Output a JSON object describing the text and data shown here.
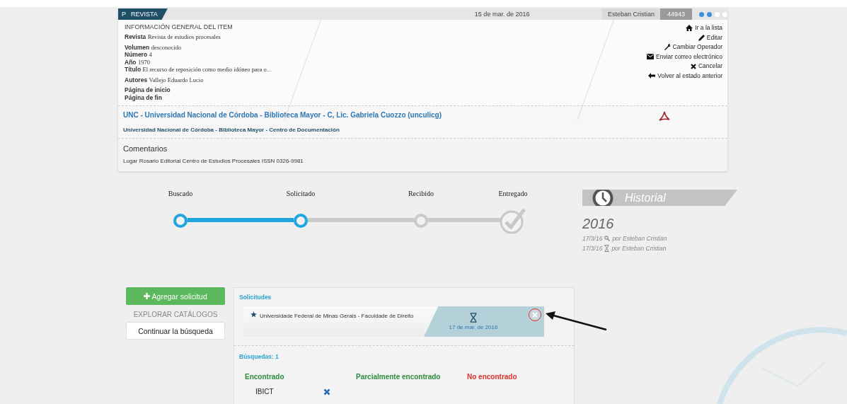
{
  "item": {
    "badge_letter": "P",
    "type": "REVISTA",
    "date": "15 de mar. de 2016",
    "operator": "Esteban Cristian",
    "id": "44943",
    "page_dots": [
      {
        "filled": true
      },
      {
        "filled": true
      },
      {
        "filled": false
      },
      {
        "filled": false
      }
    ],
    "section_title": "INFORMACIÓN GENERAL DEL ITEM",
    "field_groups": [
      [
        {
          "label": "Revista",
          "value": "Revista de estudios procesales"
        }
      ],
      [
        {
          "label": "Volumen",
          "value": "desconocido"
        },
        {
          "label": "Número",
          "value": "4"
        },
        {
          "label": "Año",
          "value": "1970"
        },
        {
          "label": "Título",
          "value": "El recurso de reposición como medio idóneo para o..."
        }
      ],
      [
        {
          "label": "Autores",
          "value": "Vallejo Eduardo Lucio"
        }
      ],
      [
        {
          "label": "Página de inicio"
        },
        {
          "label": "Página de fin"
        }
      ]
    ],
    "actions": [
      {
        "kind": "home",
        "label": "Ir a la lista"
      },
      {
        "kind": "edit",
        "label": "Editar"
      },
      {
        "kind": "wrench",
        "label": "Cambiar Operador"
      },
      {
        "kind": "mail",
        "label": "Enviar correo electrónico"
      },
      {
        "kind": "cancel",
        "label": "Cancelar"
      },
      {
        "kind": "back",
        "label": "Volver al estado anterior"
      }
    ],
    "library_link": "UNC - Universidad Nacional de Córdoba - Biblioteca Mayor - C, Lic. Gabriela Cuozzo (unculicg)",
    "library_unit": "Universidad Nacional de Córdoba - Biblioteca Mayor - Centro de Documentación",
    "comments_title": "Comentarios",
    "comments": "Lugar Rosario  Editorial Centro de Estudios Procesales  ISSN 0326-9981"
  },
  "steps": [
    {
      "label": "Buscado",
      "kind": "circle",
      "reached": true
    },
    {
      "label": "Solicitado",
      "kind": "circle",
      "reached": true
    },
    {
      "label": "Recibido",
      "kind": "circle",
      "reached": false
    },
    {
      "label": "Entregado",
      "kind": "check",
      "reached": false
    }
  ],
  "sidebar": {
    "add_button": "Agregar solicitud",
    "catalog_title": "EXPLORAR CATÁLOGOS",
    "continue_button": "Continuar la búsqueda"
  },
  "requests": {
    "title": "Solicitudes",
    "items": [
      {
        "institution": "Universidade Federal de Minas Gerais - Faculdade de Direito",
        "date": "17 de mar. de 2016"
      }
    ],
    "searches_title": "Búsquedas: 1",
    "columns": [
      {
        "label": "Encontrado",
        "kind": "found"
      },
      {
        "label": "Parcialmente encontrado",
        "kind": "partial"
      },
      {
        "label": "No encontrado",
        "kind": "missing"
      }
    ],
    "found_items": [
      "IBICT"
    ]
  },
  "history": {
    "title": "Historial",
    "year": "2016",
    "entries": [
      {
        "date": "17/3/16",
        "kind": "search",
        "text": "por Esteban Cristian"
      },
      {
        "date": "17/3/16",
        "kind": "hourglass",
        "text": "por Esteban Cristian"
      }
    ]
  }
}
